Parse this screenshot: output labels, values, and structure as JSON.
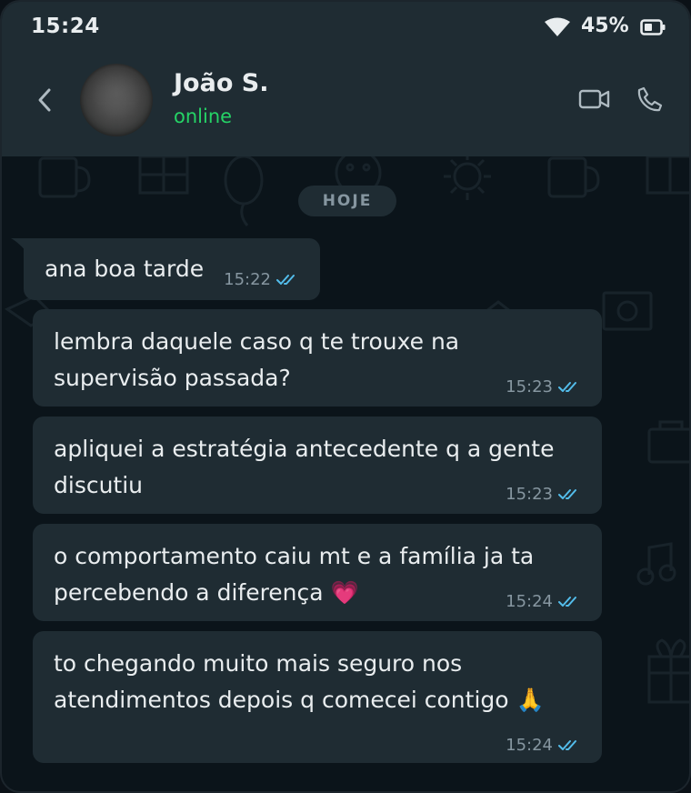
{
  "status_bar": {
    "time": "15:24",
    "battery_percent": "45%",
    "wifi_icon": "wifi-icon",
    "battery_icon": "battery-icon"
  },
  "header": {
    "contact_name": "João S.",
    "contact_status": "online",
    "icons": [
      "back-arrow-icon",
      "video-call-icon",
      "phone-call-icon"
    ]
  },
  "chat": {
    "date_label": "HOJE",
    "messages": [
      {
        "text": "ana boa tarde",
        "time": "15:22",
        "status": "read"
      },
      {
        "text": "lembra daquele caso q te trouxe na supervisão passada?",
        "time": "15:23",
        "status": "read"
      },
      {
        "text": "apliquei a estratégia antecedente q a gente discutiu",
        "time": "15:23",
        "status": "read"
      },
      {
        "text": "o comportamento caiu mt e a família ja ta percebendo a diferença 💗",
        "time": "15:24",
        "status": "read"
      },
      {
        "text": "to chegando muito mais seguro nos atendimentos depois q comecei contigo 🙏",
        "time": "15:24",
        "status": "read"
      }
    ]
  },
  "colors": {
    "header_bg": "#1f2c33",
    "chat_bg": "#0b141a",
    "bubble_bg": "#1f2c33",
    "online_green": "#25d366",
    "read_ticks": "#53bdeb"
  }
}
